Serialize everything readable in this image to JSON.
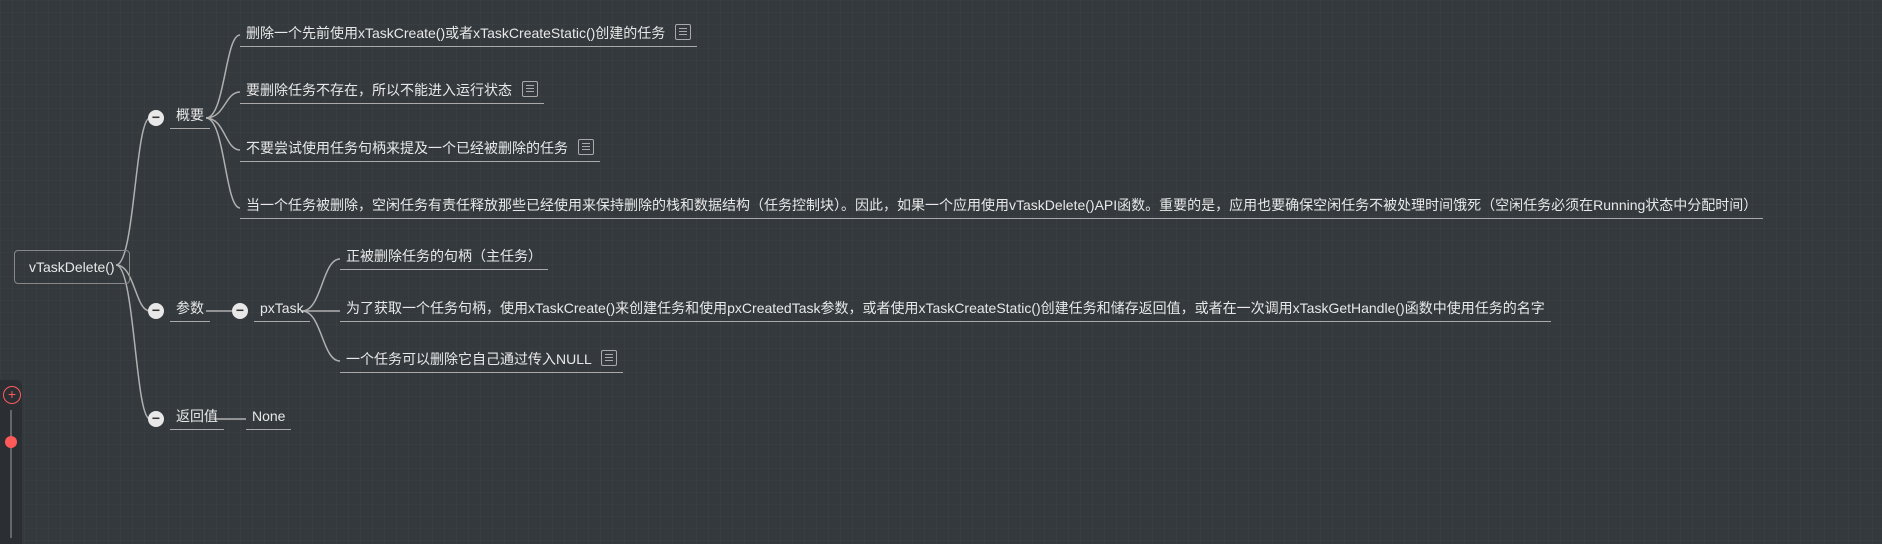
{
  "root": {
    "label": "vTaskDelete()",
    "children": [
      {
        "label": "概要",
        "children": [
          {
            "label": "删除一个先前使用xTaskCreate()或者xTaskCreateStatic()创建的任务",
            "has_note": true
          },
          {
            "label": "要删除任务不存在，所以不能进入运行状态",
            "has_note": true
          },
          {
            "label": "不要尝试使用任务句柄来提及一个已经被删除的任务",
            "has_note": true
          },
          {
            "label": "当一个任务被删除，空闲任务有责任释放那些已经使用来保持删除的栈和数据结构（任务控制块）。因此，如果一个应用使用vTaskDelete()API函数。重要的是，应用也要确保空闲任务不被处理时间饿死（空闲任务必须在Running状态中分配时间）"
          }
        ]
      },
      {
        "label": "参数",
        "children": [
          {
            "label": "pxTask",
            "children": [
              {
                "label": "正被删除任务的句柄（主任务）"
              },
              {
                "label": "为了获取一个任务句柄，使用xTaskCreate()来创建任务和使用pxCreatedTask参数，或者使用xTaskCreateStatic()创建任务和储存返回值，或者在一次调用xTaskGetHandle()函数中使用任务的名字"
              },
              {
                "label": "一个任务可以删除它自己通过传入NULL",
                "has_note": true
              }
            ]
          }
        ]
      },
      {
        "label": "返回值",
        "children": [
          {
            "label": "None"
          }
        ]
      }
    ]
  }
}
